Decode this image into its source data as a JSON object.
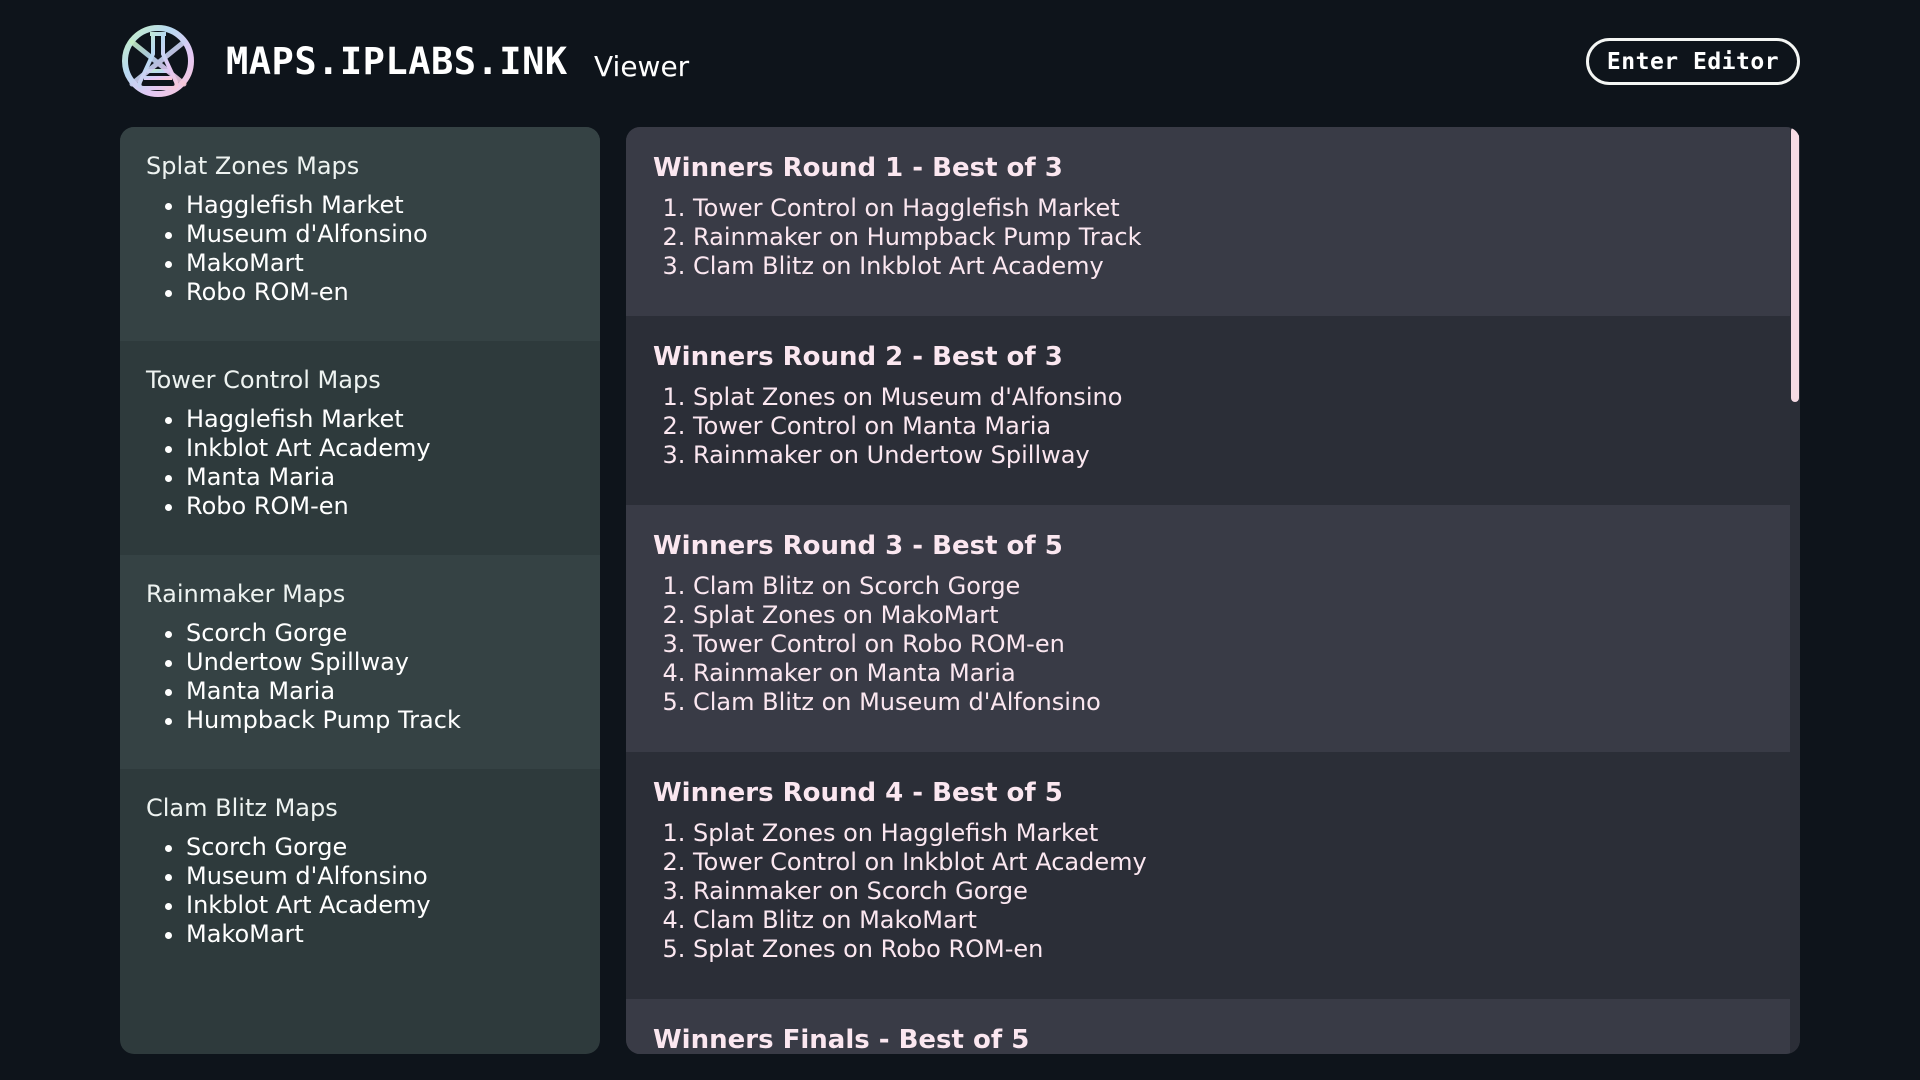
{
  "header": {
    "site_title": "MAPS.IPLABS.INK",
    "mode_label": "Viewer",
    "editor_button": "Enter Editor"
  },
  "colors": {
    "background": "#0e141b",
    "sidebar": "#2e3a3c",
    "sidebar_alt": "#354244",
    "panel": "#2b2e37",
    "panel_alt": "#393b46",
    "round_text": "#fbe7f0",
    "scrollbar_thumb": "#f6dbe4"
  },
  "sidebar": {
    "sections": [
      {
        "title": "Splat Zones Maps",
        "maps": [
          "Hagglefish Market",
          "Museum d'Alfonsino",
          "MakoMart",
          "Robo ROM-en"
        ]
      },
      {
        "title": "Tower Control Maps",
        "maps": [
          "Hagglefish Market",
          "Inkblot Art Academy",
          "Manta Maria",
          "Robo ROM-en"
        ]
      },
      {
        "title": "Rainmaker Maps",
        "maps": [
          "Scorch Gorge",
          "Undertow Spillway",
          "Manta Maria",
          "Humpback Pump Track"
        ]
      },
      {
        "title": "Clam Blitz Maps",
        "maps": [
          "Scorch Gorge",
          "Museum d'Alfonsino",
          "Inkblot Art Academy",
          "MakoMart"
        ]
      }
    ]
  },
  "rounds": [
    {
      "title": "Winners Round 1 - Best of 3",
      "games": [
        "Tower Control on Hagglefish Market",
        "Rainmaker on Humpback Pump Track",
        "Clam Blitz on Inkblot Art Academy"
      ]
    },
    {
      "title": "Winners Round 2 - Best of 3",
      "games": [
        "Splat Zones on Museum d'Alfonsino",
        "Tower Control on Manta Maria",
        "Rainmaker on Undertow Spillway"
      ]
    },
    {
      "title": "Winners Round 3 - Best of 5",
      "games": [
        "Clam Blitz on Scorch Gorge",
        "Splat Zones on MakoMart",
        "Tower Control on Robo ROM-en",
        "Rainmaker on Manta Maria",
        "Clam Blitz on Museum d'Alfonsino"
      ]
    },
    {
      "title": "Winners Round 4 - Best of 5",
      "games": [
        "Splat Zones on Hagglefish Market",
        "Tower Control on Inkblot Art Academy",
        "Rainmaker on Scorch Gorge",
        "Clam Blitz on MakoMart",
        "Splat Zones on Robo ROM-en"
      ]
    },
    {
      "title": "Winners Finals - Best of 5",
      "games": []
    }
  ],
  "icons": {
    "logo": "iplabs-flask-logo-icon"
  }
}
